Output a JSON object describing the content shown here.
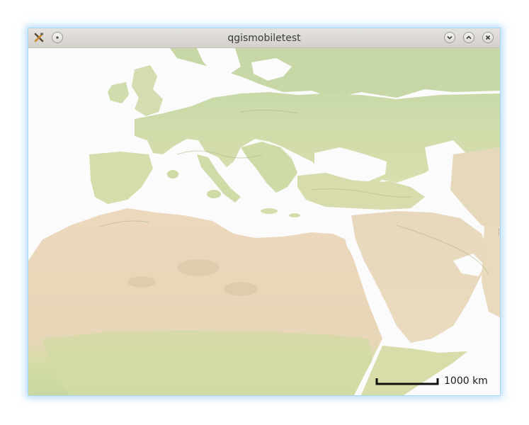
{
  "window": {
    "title": "qgismobiletest"
  },
  "titlebar": {
    "app_icon": "qgis-tools-icon",
    "left_button_icon": "window-menu-icon",
    "buttons": [
      "minimize-icon",
      "maximize-icon",
      "close-icon"
    ]
  },
  "map": {
    "scale_label": "1000 km"
  },
  "colors": {
    "window_glow": "#a9d8f5",
    "titlebar": "#d8d5d1",
    "sea": "#fbfbfb",
    "land_green": "#cfdcae",
    "land_desert": "#ead7bd"
  }
}
